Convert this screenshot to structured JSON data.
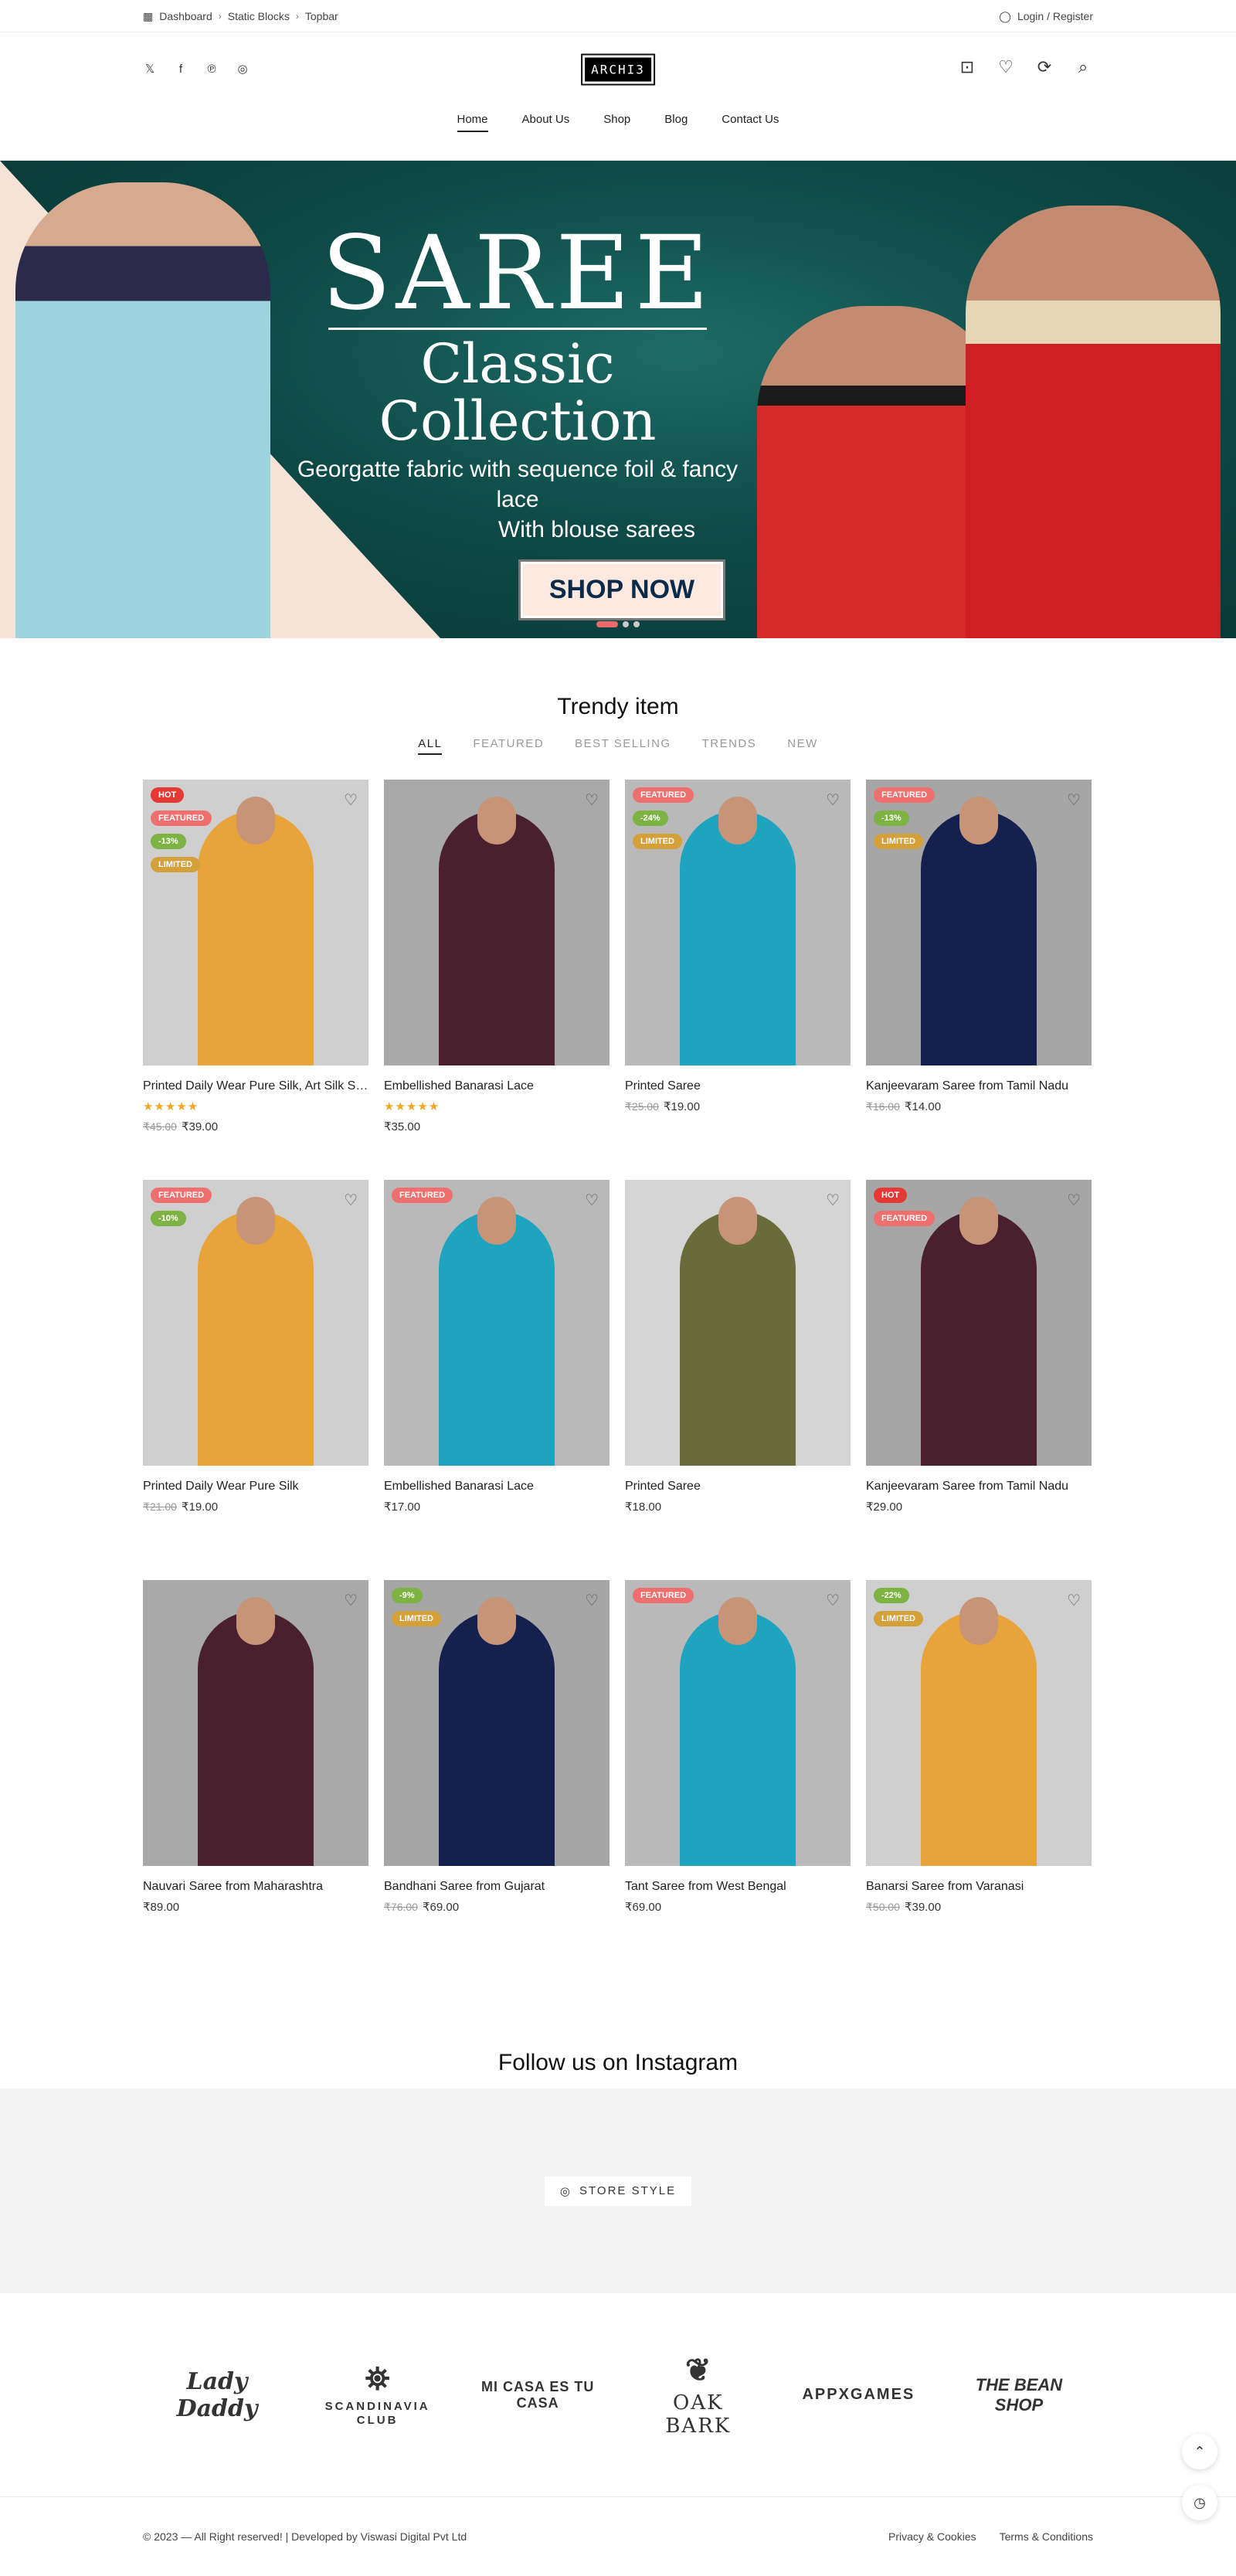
{
  "topbar": {
    "crumbs": [
      "Dashboard",
      "Static Blocks",
      "Topbar"
    ],
    "login": "Login / Register"
  },
  "header": {
    "logo": "ARCHI3",
    "nav": [
      "Home",
      "About Us",
      "Shop",
      "Blog",
      "Contact Us"
    ],
    "active_nav": "Home"
  },
  "hero": {
    "title": "SAREE",
    "subtitle": "Classic Collection",
    "desc_line1": "Georgatte fabric with sequence foil & fancy lace",
    "desc_line2": "With blouse sarees",
    "button": "SHOP NOW"
  },
  "trendy": {
    "title": "Trendy item",
    "tabs": [
      "ALL",
      "FEATURED",
      "BEST SELLING",
      "TRENDS",
      "NEW"
    ],
    "products": [
      {
        "name": "Printed Daily Wear Pure Silk, Art Silk Saree",
        "badges": [
          "HOT",
          "FEATURED",
          "-13%",
          "LIMITED"
        ],
        "stars": "★★★★★",
        "old": "₹45.00",
        "price": "₹39.00"
      },
      {
        "name": "Embellished Banarasi Lace",
        "badges": [],
        "stars": "★★★★★",
        "old": "",
        "price": "₹35.00"
      },
      {
        "name": "Printed Saree",
        "badges": [
          "FEATURED",
          "-24%",
          "LIMITED"
        ],
        "stars": "",
        "old": "₹25.00",
        "price": "₹19.00"
      },
      {
        "name": "Kanjeevaram Saree from Tamil Nadu",
        "badges": [
          "FEATURED",
          "-13%",
          "LIMITED"
        ],
        "stars": "",
        "old": "₹16.00",
        "price": "₹14.00"
      },
      {
        "name": "Printed Daily Wear Pure Silk",
        "badges": [
          "FEATURED",
          "-10%"
        ],
        "stars": "",
        "old": "₹21.00",
        "price": "₹19.00"
      },
      {
        "name": "Embellished Banarasi Lace",
        "badges": [
          "FEATURED"
        ],
        "stars": "",
        "old": "",
        "price": "₹17.00"
      },
      {
        "name": "Printed Saree",
        "badges": [],
        "stars": "",
        "old": "",
        "price": "₹18.00"
      },
      {
        "name": "Kanjeevaram Saree from Tamil Nadu",
        "badges": [
          "HOT",
          "FEATURED"
        ],
        "stars": "",
        "old": "",
        "price": "₹29.00"
      },
      {
        "name": "Nauvari Saree from Maharashtra",
        "badges": [],
        "stars": "",
        "old": "",
        "price": "₹89.00"
      },
      {
        "name": "Bandhani Saree from Gujarat",
        "badges": [
          "-9%",
          "LIMITED"
        ],
        "stars": "",
        "old": "₹76.00",
        "price": "₹69.00"
      },
      {
        "name": "Tant Saree from West Bengal",
        "badges": [
          "FEATURED"
        ],
        "stars": "",
        "old": "",
        "price": "₹69.00"
      },
      {
        "name": "Banarsi Saree from Varanasi",
        "badges": [
          "-22%",
          "LIMITED"
        ],
        "stars": "",
        "old": "₹50.00",
        "price": "₹39.00"
      }
    ]
  },
  "instagram": {
    "title": "Follow us on Instagram",
    "button": "STORE STYLE"
  },
  "brands": [
    "Lady Daddy",
    "SCANDINAVIA CLUB",
    "MI CASA ES TU CASA",
    "OAK BARK",
    "APPXGAMES",
    "THE BEAN SHOP"
  ],
  "footer": {
    "copyright": "© 2023 — All Right reserved! | Developed by Viswasi Digital Pvt Ltd",
    "links": [
      "Privacy & Cookies",
      "Terms & Conditions"
    ]
  },
  "colors": {
    "hot": "#e53935",
    "featured": "#ef6f6f",
    "discount": "#7cb342",
    "limited": "#d4a03a",
    "star": "#f5a623"
  }
}
